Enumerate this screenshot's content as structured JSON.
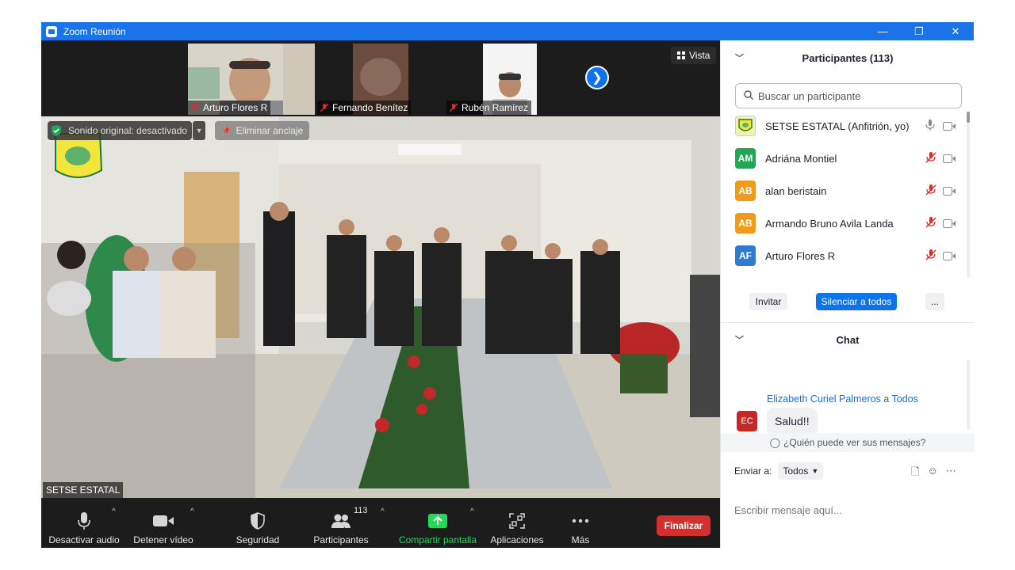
{
  "window": {
    "title": "Zoom Reunión",
    "controls": [
      "—",
      "❐",
      "✕"
    ]
  },
  "strip": {
    "thumbnails": [
      {
        "name": "Arturo Flores R"
      },
      {
        "name": "Fernando Benítez"
      },
      {
        "name": "Rubén Ramírez"
      }
    ],
    "view_label": "Vista"
  },
  "main": {
    "original_sound": "Sonido original: desactivado",
    "unpin": "Eliminar anclaje",
    "speaker": "SETSE ESTATAL"
  },
  "toolbar": {
    "mute": "Desactivar audio",
    "video": "Detener vídeo",
    "security": "Seguridad",
    "participants": "Participantes",
    "participant_count": "113",
    "share": "Compartir pantalla",
    "apps": "Aplicaciones",
    "more": "Más",
    "end": "Finalizar"
  },
  "participants": {
    "header": "Participantes (113)",
    "search_placeholder": "Buscar un participante",
    "list": [
      {
        "initials": "",
        "name": "SETSE ESTATAL (Anfitrión, yo)",
        "color": "#f3f3b0"
      },
      {
        "initials": "AM",
        "name": "Adriána Montiel",
        "color": "#23a55a"
      },
      {
        "initials": "AB",
        "name": "alan beristain",
        "color": "#f29b1b"
      },
      {
        "initials": "AB",
        "name": "Armando Bruno Avila Landa",
        "color": "#f29b1b"
      },
      {
        "initials": "AF",
        "name": "Arturo Flores R",
        "color": "#2e7bcf"
      }
    ],
    "invite": "Invitar",
    "mute_all": "Silenciar a todos",
    "more": "..."
  },
  "chat": {
    "header": "Chat",
    "message": {
      "sender": "Elizabeth Curiel Palmeros",
      "to_word": "a",
      "recipient": "Todos",
      "initials": "EC",
      "text": "Salud!!"
    },
    "who_can_see": "¿Quién puede ver sus mensajes?",
    "send_to_label": "Enviar a:",
    "send_to_value": "Todos",
    "input_placeholder": "Escribir mensaje aquí..."
  },
  "colors": {
    "accent": "#0e72ed",
    "end": "#d32f2f",
    "share": "#23d959",
    "mic_off": "#e02828"
  }
}
